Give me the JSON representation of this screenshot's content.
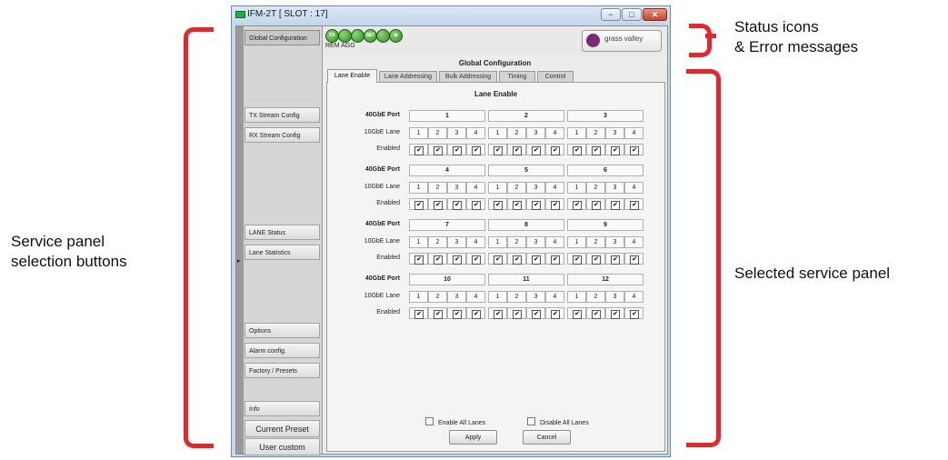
{
  "window": {
    "title": "IFM-2T [ SLOT : 17]",
    "controls": [
      "minimize-icon",
      "restore-icon",
      "close-icon"
    ]
  },
  "callouts": {
    "status_line1": "Status icons",
    "status_line2": "& Error messages",
    "service_panel_line1": "Service panel",
    "service_panel_line2": "selection buttons",
    "selected_panel": "Selected service panel",
    "bracket_color": "#e8252b"
  },
  "sidebar": {
    "buttons": [
      {
        "label": "Global Configuration",
        "active": true
      },
      {
        "label": "TX Stream Config"
      },
      {
        "label": "RX Stream Config"
      },
      {
        "label": "LANE Status"
      },
      {
        "label": "Lane Statistics"
      },
      {
        "label": "Options"
      },
      {
        "label": "Alarm config."
      },
      {
        "label": "Factory / Presets"
      },
      {
        "label": "Info"
      },
      {
        "label": "Current Preset"
      },
      {
        "label": "User custom"
      }
    ]
  },
  "status": {
    "icons": [
      "TX",
      "",
      "",
      "SET",
      "",
      "+"
    ],
    "text": "REM AGG",
    "logo_text": "grass valley",
    "logo_color": "#7b2a6e"
  },
  "panel": {
    "title": "Global Configuration",
    "tabs": [
      {
        "label": "Lane Enable",
        "active": true
      },
      {
        "label": "Lane Addressing"
      },
      {
        "label": "Bulk Addressing"
      },
      {
        "label": "Timing"
      },
      {
        "label": "Control"
      }
    ],
    "subtitle": "Lane Enable",
    "row_labels": {
      "port": "40GbE Port",
      "lane": "10GbE Lane",
      "enabled": "Enabled"
    },
    "lane_numbers": [
      "1",
      "2",
      "3",
      "4"
    ],
    "groups": [
      {
        "ports": [
          "1",
          "2",
          "3"
        ]
      },
      {
        "ports": [
          "4",
          "5",
          "6"
        ]
      },
      {
        "ports": [
          "7",
          "8",
          "9"
        ]
      },
      {
        "ports": [
          "10",
          "11",
          "12"
        ]
      }
    ],
    "lane_enabled": true,
    "enable_all_label": "Enable All Lanes",
    "disable_all_label": "Disable All Lanes",
    "apply_label": "Apply",
    "cancel_label": "Cancel"
  }
}
